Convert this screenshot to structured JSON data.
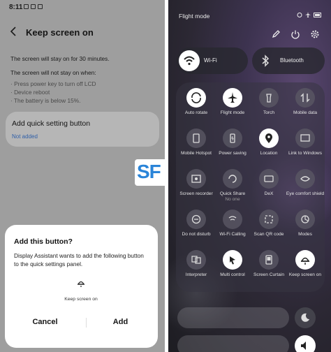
{
  "left": {
    "status_time": "8:11",
    "header_title": "Keep screen on",
    "line1": "The screen will stay on for 30 minutes.",
    "line2": "The screen will not stay on when:",
    "bullets": [
      "· Press power key to turn off LCD",
      "· Device reboot",
      "· The battery is below 15%."
    ],
    "card_title": "Add quick setting button",
    "card_status": "Not added",
    "dialog": {
      "title": "Add this button?",
      "body": "Display Assistant wants to add the following button to the quick settings panel.",
      "tile_label": "Keep screen on",
      "cancel": "Cancel",
      "add": "Add"
    }
  },
  "watermark": "SF",
  "right": {
    "mode_label": "Flight mode",
    "wifi_label": "Wi-Fi",
    "bluetooth_label": "Bluetooth",
    "tiles": [
      {
        "label": "Auto rotate",
        "on": true
      },
      {
        "label": "Flight mode",
        "on": true
      },
      {
        "label": "Torch",
        "on": false
      },
      {
        "label": "Mobile data",
        "on": false
      },
      {
        "label": "Mobile Hotspot",
        "on": false
      },
      {
        "label": "Power saving",
        "on": false
      },
      {
        "label": "Location",
        "on": true
      },
      {
        "label": "Link to Windows",
        "on": false
      },
      {
        "label": "Screen recorder",
        "on": false
      },
      {
        "label": "Quick Share",
        "sub": "No one",
        "on": false
      },
      {
        "label": "DeX",
        "on": false
      },
      {
        "label": "Eye comfort shield",
        "on": false
      },
      {
        "label": "Do not disturb",
        "on": false
      },
      {
        "label": "Wi-Fi Calling",
        "on": false
      },
      {
        "label": "Scan QR code",
        "on": false
      },
      {
        "label": "Modes",
        "on": false
      },
      {
        "label": "Interpreter",
        "on": false
      },
      {
        "label": "Multi control",
        "on": true
      },
      {
        "label": "Screen Curtain",
        "on": false
      },
      {
        "label": "Keep screen on",
        "on": true
      }
    ]
  }
}
